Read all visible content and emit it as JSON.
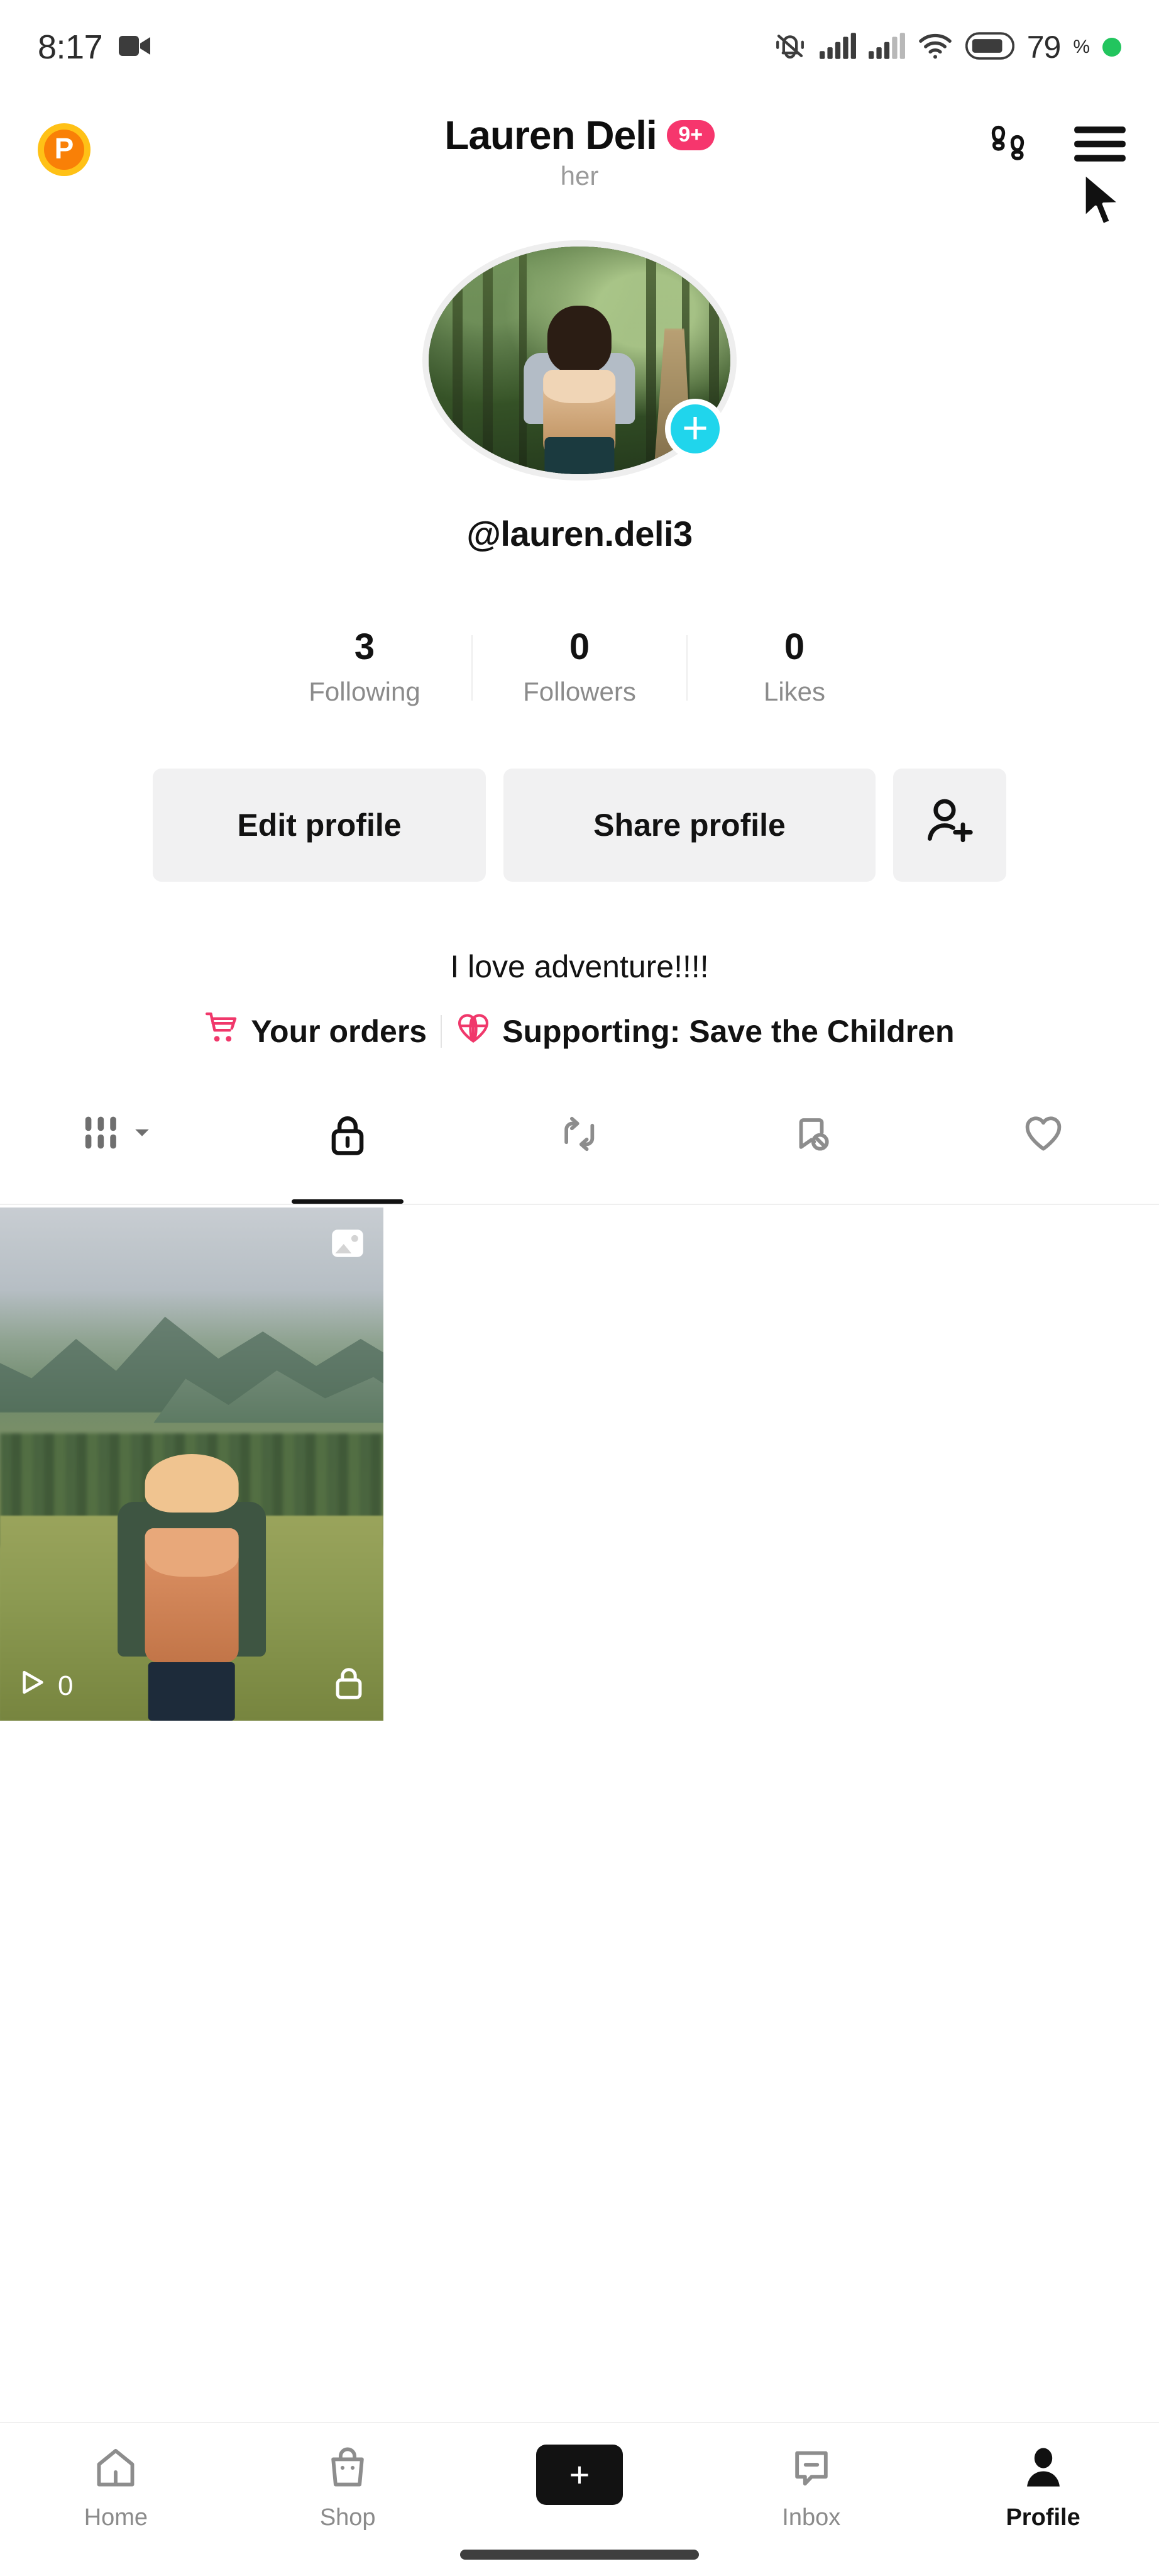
{
  "status_bar": {
    "time": "8:17",
    "camera_icon": "video-camera-icon",
    "silent_icon": "bell-silent-icon",
    "signal1_icon": "cellular-signal-icon",
    "signal2_icon": "cellular-signal-icon",
    "wifi_icon": "wifi-icon",
    "battery_icon": "battery-icon",
    "battery_percent": "79",
    "battery_unit": "%",
    "recording_dot": "green-recording-dot"
  },
  "header": {
    "points_badge": "P",
    "display_name": "Lauren Deli",
    "notification_badge": "9+",
    "pronouns": "her",
    "footprints_icon": "footprints-icon",
    "menu_icon": "hamburger-menu-icon"
  },
  "profile": {
    "avatar_alt": "woman-hiking-in-forest-avatar",
    "add_story_label": "+",
    "handle": "@lauren.deli3",
    "stats": [
      {
        "count": "3",
        "label": "Following"
      },
      {
        "count": "0",
        "label": "Followers"
      },
      {
        "count": "0",
        "label": "Likes"
      }
    ],
    "buttons": {
      "edit_profile": "Edit profile",
      "share_profile": "Share profile",
      "add_friends_icon": "add-user-icon"
    },
    "bio": "I love adventure!!!!",
    "orders_label": "Your orders",
    "orders_icon": "shopping-cart-icon",
    "supporting_label": "Supporting: Save the Children",
    "supporting_icon": "heart-globe-icon"
  },
  "content_tabs": [
    {
      "icon": "playlist-grid-icon",
      "name": "playlists",
      "active": false,
      "has_chevron": true
    },
    {
      "icon": "lock-icon",
      "name": "private",
      "active": true,
      "has_chevron": false
    },
    {
      "icon": "repost-icon",
      "name": "reposts",
      "active": false,
      "has_chevron": false
    },
    {
      "icon": "saved-hidden-icon",
      "name": "saved",
      "active": false,
      "has_chevron": false
    },
    {
      "icon": "heart-icon",
      "name": "liked",
      "active": false,
      "has_chevron": false
    }
  ],
  "videos": [
    {
      "thumb_alt": "hiker-overlooking-mountain-valley",
      "media_type_icon": "photo-stack-icon",
      "play_icon": "play-icon",
      "play_count": "0",
      "privacy_icon": "lock-icon"
    }
  ],
  "bottom_nav": [
    {
      "label": "Home",
      "icon": "home-icon",
      "active": false
    },
    {
      "label": "Shop",
      "icon": "shopping-bag-icon",
      "active": false
    },
    {
      "label": "",
      "icon": "create-plus-icon",
      "active": false
    },
    {
      "label": "Inbox",
      "icon": "inbox-message-icon",
      "active": false
    },
    {
      "label": "Profile",
      "icon": "person-icon",
      "active": true
    }
  ],
  "colors": {
    "accent_pink": "#f6366d",
    "accent_cyan": "#20d5ec",
    "brand_red": "#ff2e54",
    "points_orange": "#f98007",
    "text_primary": "#121212",
    "text_muted": "#8b8b8b",
    "button_bg": "#f1f1f2"
  }
}
